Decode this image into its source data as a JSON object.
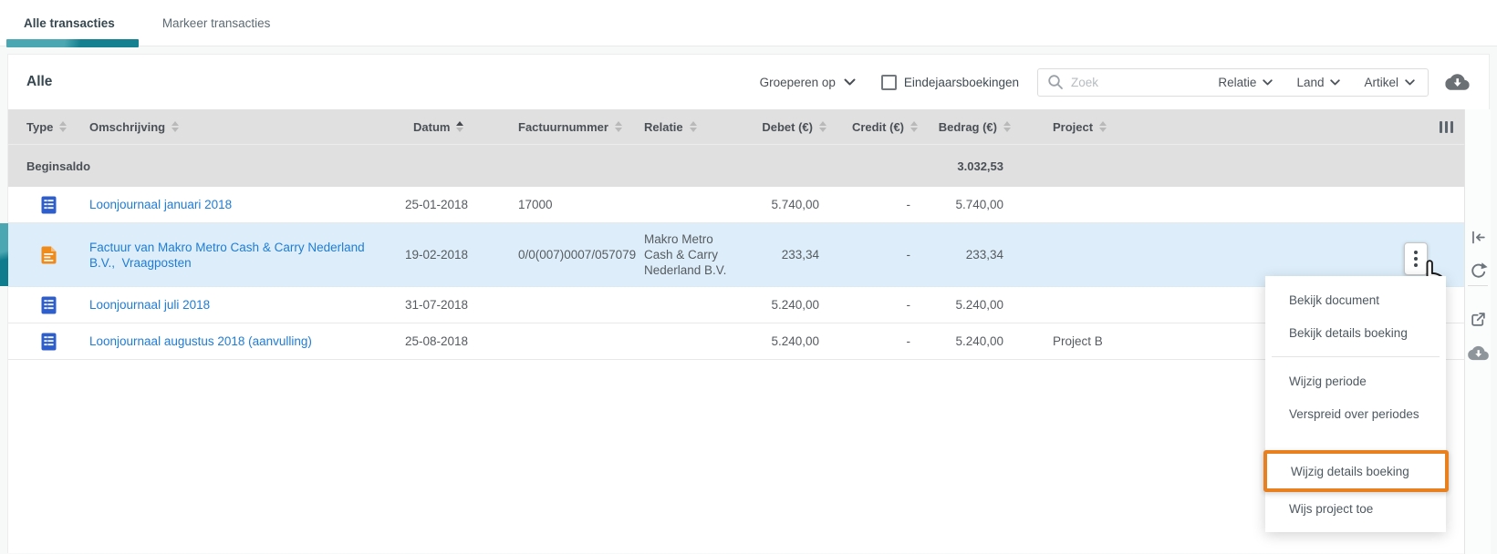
{
  "tabs": [
    {
      "label": "Alle transacties",
      "active": true
    },
    {
      "label": "Markeer transacties",
      "active": false
    }
  ],
  "toolbar": {
    "title": "Alle",
    "group_by_label": "Groeperen op",
    "year_end_checkbox_label": "Eindejaarsboekingen",
    "year_end_checked": false,
    "search_placeholder": "Zoek",
    "filters": [
      "Relatie",
      "Land",
      "Artikel"
    ]
  },
  "table": {
    "columns": [
      {
        "label": "Type",
        "sort": "inactive"
      },
      {
        "label": "Omschrijving",
        "sort": "inactive"
      },
      {
        "label": "Datum",
        "sort": "asc"
      },
      {
        "label": "Factuurnummer",
        "sort": "inactive"
      },
      {
        "label": "Relatie",
        "sort": "inactive"
      },
      {
        "label": "Debet (€)",
        "sort": "inactive"
      },
      {
        "label": "Credit (€)",
        "sort": "inactive"
      },
      {
        "label": "Bedrag (€)",
        "sort": "inactive"
      },
      {
        "label": "Project",
        "sort": "inactive"
      }
    ],
    "opening_balance": {
      "label": "Beginsaldo",
      "bedrag": "3.032,53"
    },
    "rows": [
      {
        "icon": "journal-document-icon",
        "omschrijving": "Loonjournaal januari 2018",
        "datum": "25-01-2018",
        "factuurnummer": "17000",
        "relatie": "",
        "debet": "5.740,00",
        "credit": "-",
        "bedrag": "5.740,00",
        "project": "",
        "highlighted": false
      },
      {
        "icon": "invoice-document-icon",
        "omschrijving": "Factuur van Makro Metro Cash & Carry Nederland B.V.,  Vraagposten",
        "datum": "19-02-2018",
        "factuurnummer": "0/0(007)0007/057079",
        "relatie": "Makro Metro Cash & Carry Nederland B.V.",
        "debet": "233,34",
        "credit": "-",
        "bedrag": "233,34",
        "project": "",
        "highlighted": true
      },
      {
        "icon": "journal-document-icon",
        "omschrijving": "Loonjournaal juli 2018",
        "datum": "31-07-2018",
        "factuurnummer": "",
        "relatie": "",
        "debet": "5.240,00",
        "credit": "-",
        "bedrag": "5.240,00",
        "project": "",
        "highlighted": false
      },
      {
        "icon": "journal-document-icon",
        "omschrijving": "Loonjournaal augustus 2018 (aanvulling)",
        "datum": "25-08-2018",
        "factuurnummer": "",
        "relatie": "",
        "debet": "5.240,00",
        "credit": "-",
        "bedrag": "5.240,00",
        "project": "Project B",
        "highlighted": false
      }
    ]
  },
  "context_menu": {
    "items": [
      {
        "label": "Bekijk document",
        "highlighted": false
      },
      {
        "label": "Bekijk details boeking",
        "highlighted": false
      },
      {
        "label": "Wijzig periode",
        "highlighted": false
      },
      {
        "label": "Verspreid over periodes",
        "highlighted": false
      },
      {
        "label": "Wijzig details boeking",
        "highlighted": true
      },
      {
        "label": "Wijs project toe",
        "highlighted": false
      }
    ]
  },
  "colors": {
    "accent_teal": "#15808F",
    "accent_teal_light": "#4BA7B2",
    "link_blue": "#1E7CD7",
    "highlight_orange": "#E8801F",
    "row_highlight_blue": "#DDEEFA",
    "table_header_gray": "#E0E0E0"
  }
}
